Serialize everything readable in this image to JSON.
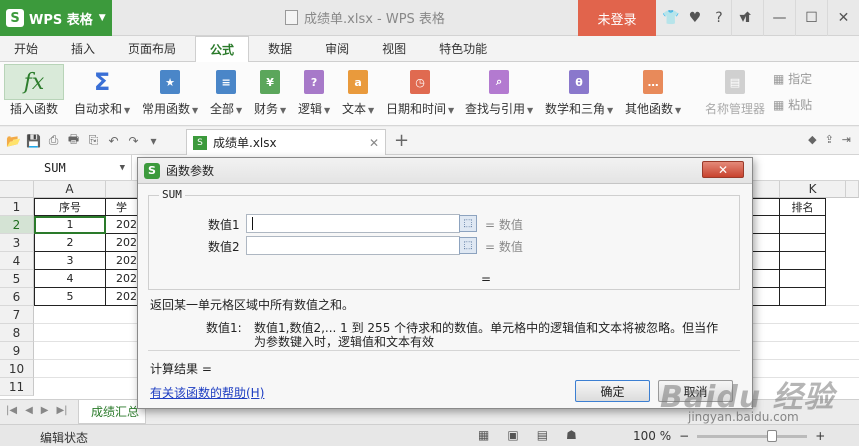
{
  "app": {
    "name": "WPS 表格",
    "doc_title": "成绩单.xlsx - WPS 表格",
    "login": "未登录"
  },
  "ribbon_tabs": [
    "开始",
    "插入",
    "页面布局",
    "公式",
    "数据",
    "审阅",
    "视图",
    "特色功能"
  ],
  "ribbon": {
    "insert_fn": "插入函数",
    "autosum": "自动求和",
    "common": "常用函数",
    "all": "全部",
    "finance": "财务",
    "logic": "逻辑",
    "text": "文本",
    "datetime": "日期和时间",
    "lookup": "查找与引用",
    "math": "数学和三角",
    "other": "其他函数",
    "name_mgr": "名称管理器",
    "define": "指定",
    "paste": "粘贴"
  },
  "doc_tab": "成绩单.xlsx",
  "name_box": "SUM",
  "columns": [
    "A",
    "K"
  ],
  "header_row": {
    "a": "序号",
    "b": "学",
    "k": "排名"
  },
  "rows": [
    {
      "num": "1",
      "a": "1",
      "b": "202"
    },
    {
      "num": "2",
      "a": "2",
      "b": "202"
    },
    {
      "num": "3",
      "a": "3",
      "b": "202"
    },
    {
      "num": "4",
      "a": "4",
      "b": "202"
    },
    {
      "num": "5",
      "a": "5",
      "b": "202"
    }
  ],
  "row_numbers": [
    "1",
    "2",
    "3",
    "4",
    "5",
    "6",
    "7",
    "8",
    "9",
    "10",
    "11"
  ],
  "sheet_tab": "成绩汇总",
  "status": {
    "mode": "编辑状态",
    "zoom": "100 %"
  },
  "dialog": {
    "title": "函数参数",
    "function": "SUM",
    "arg1_label": "数值1",
    "arg2_label": "数值2",
    "arg_result": "= 数值",
    "total_eq": "=",
    "description": "返回某一单元格区域中所有数值之和。",
    "param_name": "数值1:",
    "param_desc_1": "数值1,数值2,... 1 到 255 个待求和的数值。单元格中的逻辑值和文本将被忽略。但当作",
    "param_desc_2": "为参数键入时，逻辑值和文本有效",
    "result_label": "计算结果 =",
    "help_link": "有关该函数的帮助(H)",
    "ok": "确定",
    "cancel": "取消"
  },
  "watermark": {
    "main": "Baidu 经验",
    "sub": "jingyan.baidu.com"
  },
  "colors": {
    "brand": "#3c9a3c",
    "login": "#e1644c",
    "link": "#1e3ec2"
  }
}
